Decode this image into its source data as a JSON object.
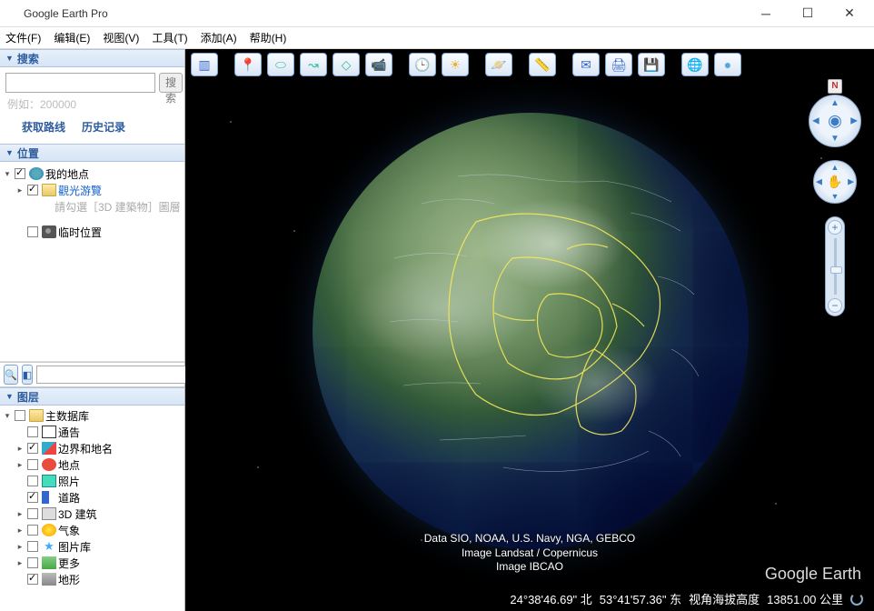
{
  "title": "Google Earth Pro",
  "menu": {
    "file": "文件(F)",
    "edit": "编辑(E)",
    "view": "视图(V)",
    "tools": "工具(T)",
    "add": "添加(A)",
    "help": "帮助(H)"
  },
  "panels": {
    "search": "搜索",
    "places": "位置",
    "layers": "图层"
  },
  "search": {
    "button": "搜索",
    "hint": "例如：200000",
    "directions": "获取路线",
    "history": "历史记录"
  },
  "places": {
    "my_places": "我的地点",
    "sightseeing": "觀光游覽",
    "sightseeing_hint": "請勾選［3D 建築物］圖層",
    "temporary": "临时位置"
  },
  "layers": {
    "primary_db": "主数据库",
    "announcements": "通告",
    "borders_labels": "边界和地名",
    "places": "地点",
    "photos": "照片",
    "roads": "道路",
    "buildings_3d": "3D 建筑",
    "weather": "气象",
    "gallery": "图片库",
    "more": "更多",
    "terrain": "地形"
  },
  "attribution": {
    "line1": "Data SIO, NOAA, U.S. Navy, NGA, GEBCO",
    "line2": "Image Landsat / Copernicus",
    "line3": "Image IBCAO"
  },
  "status": {
    "lat": "24°38'46.69\" 北",
    "lon": "53°41'57.36\" 东",
    "eye_label": "视角海拔高度",
    "eye_alt": "13851.00 公里"
  },
  "watermark": "Google Earth",
  "nav": {
    "north": "N"
  }
}
